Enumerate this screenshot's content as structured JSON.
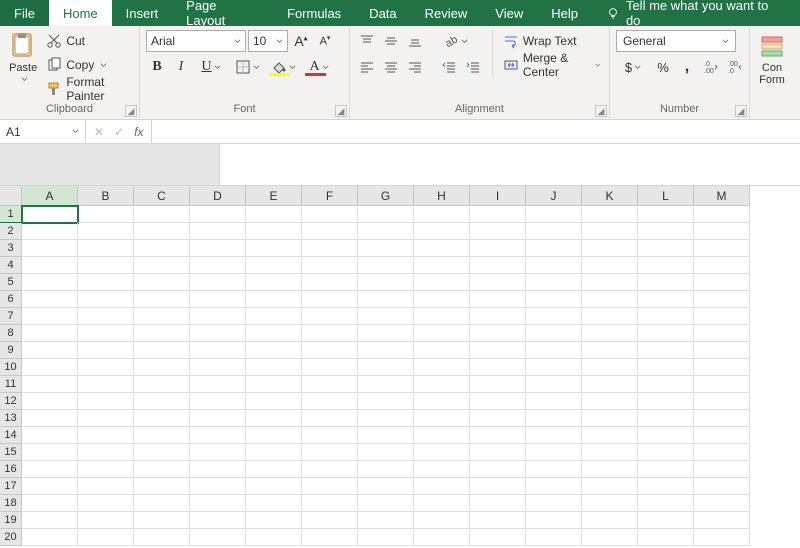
{
  "tabs": [
    "File",
    "Home",
    "Insert",
    "Page Layout",
    "Formulas",
    "Data",
    "Review",
    "View",
    "Help"
  ],
  "active_tab": "Home",
  "tell_me": "Tell me what you want to do",
  "clipboard": {
    "paste": "Paste",
    "cut": "Cut",
    "copy": "Copy",
    "format_painter": "Format Painter",
    "group": "Clipboard"
  },
  "font": {
    "name": "Arial",
    "size": "10",
    "bold": "B",
    "italic": "I",
    "underline": "U",
    "group": "Font",
    "grow": "A",
    "shrink": "A",
    "fill_color": "#ffff00",
    "font_color": "#d13438"
  },
  "alignment": {
    "wrap": "Wrap Text",
    "merge": "Merge & Center",
    "group": "Alignment"
  },
  "number": {
    "format": "General",
    "group": "Number",
    "currency": "$",
    "percent": "%",
    "comma": ","
  },
  "cond": {
    "label1": "Con",
    "label2": "Form"
  },
  "name_box": "A1",
  "fx": "fx",
  "columns": [
    "A",
    "B",
    "C",
    "D",
    "E",
    "F",
    "G",
    "H",
    "I",
    "J",
    "K",
    "L",
    "M"
  ],
  "rows": 20,
  "active_cell": {
    "row": 1,
    "col": "A"
  }
}
